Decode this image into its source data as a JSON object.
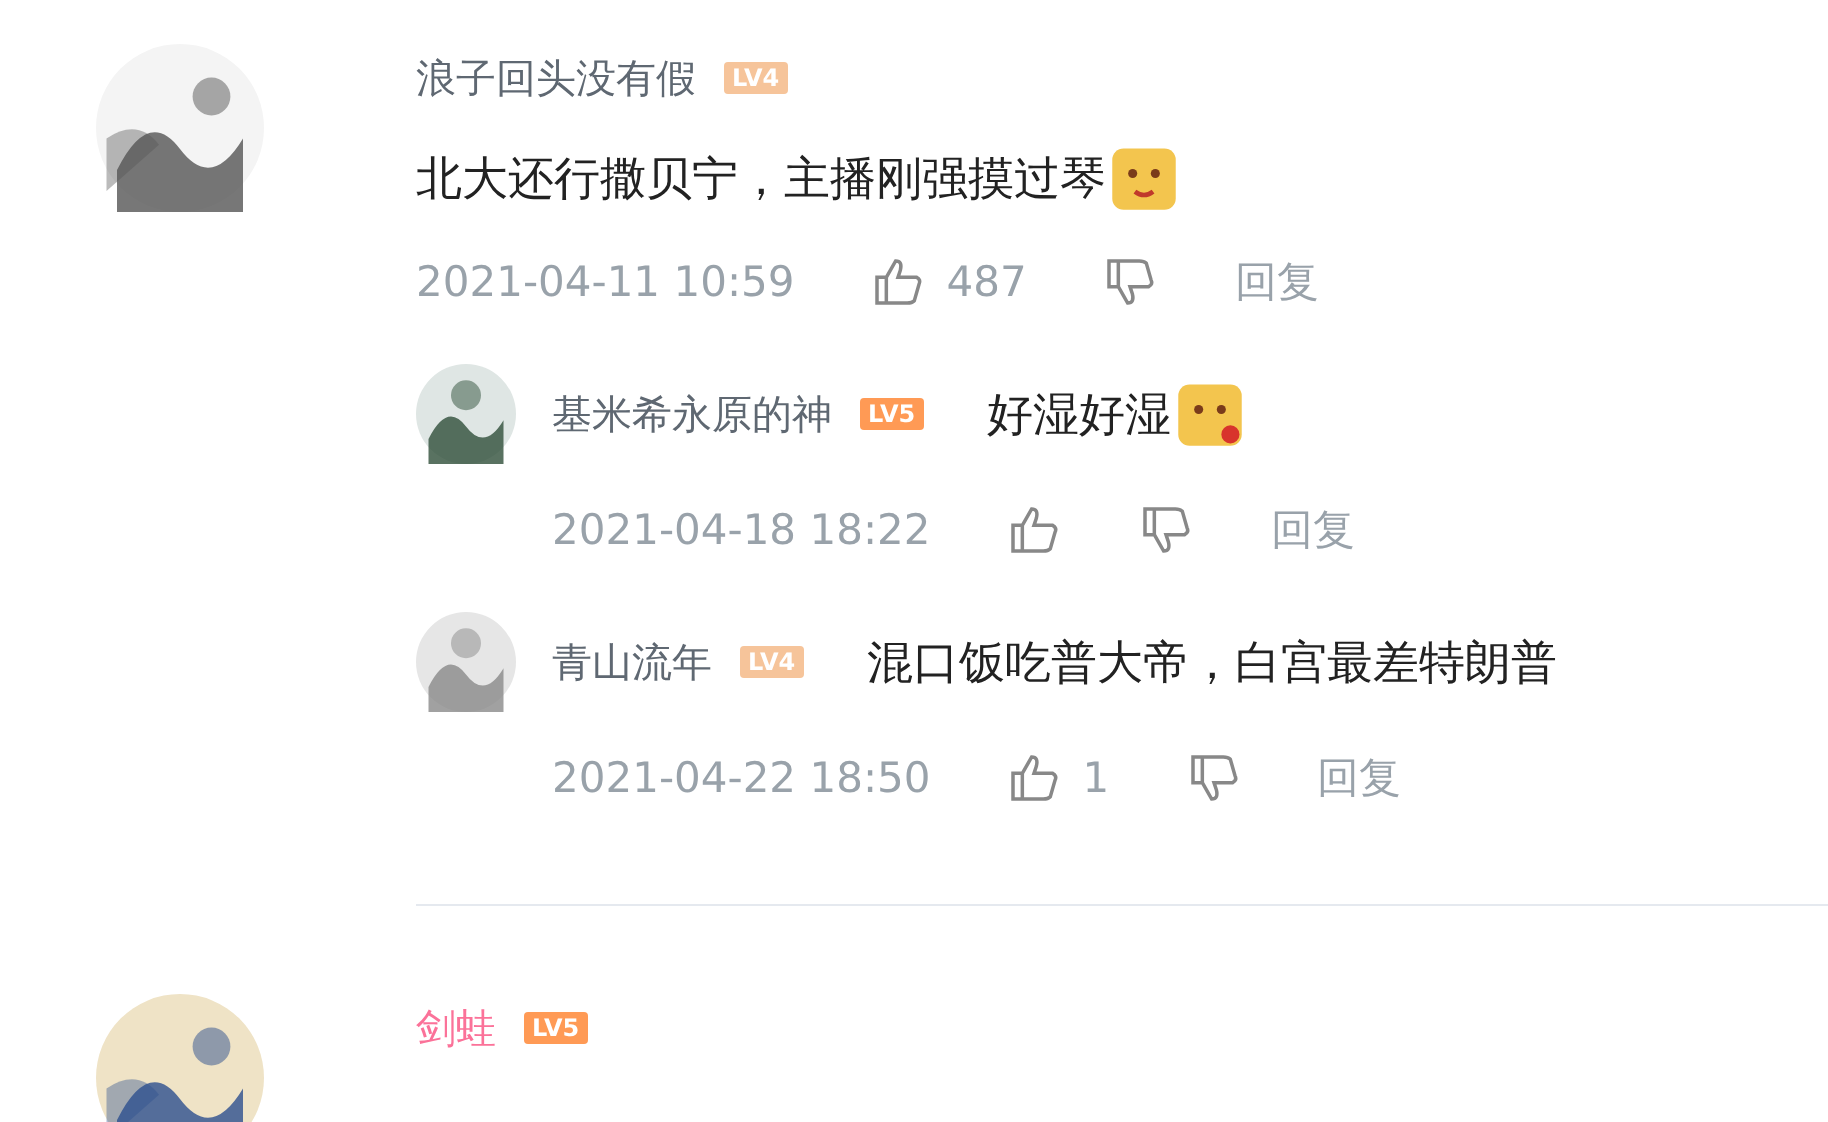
{
  "comments": [
    {
      "user": "浪子回头没有假",
      "vip": false,
      "badge": {
        "label": "LV4",
        "color": "#f6c49a"
      },
      "content": "北大还行撒贝宁，主播刚强摸过琴",
      "emoji": true,
      "time": "2021-04-11 10:59",
      "likes": "487",
      "reply_label": "回复",
      "replies": [
        {
          "user": "基米希永原的神",
          "vip": false,
          "badge": {
            "label": "LV5",
            "color": "#ff9a55"
          },
          "content": "好湿好湿",
          "emoji": true,
          "time": "2021-04-18 18:22",
          "reply_label": "回复"
        },
        {
          "user": "青山流年",
          "vip": false,
          "badge": {
            "label": "LV4",
            "color": "#f6c49a"
          },
          "content": "混口饭吃普大帝，白宫最差特朗普",
          "emoji": false,
          "time": "2021-04-22 18:50",
          "likes": "1",
          "reply_label": "回复"
        }
      ]
    },
    {
      "user": "剑蛙",
      "vip": true,
      "badge": {
        "label": "LV5",
        "color": "#ff9a55"
      }
    }
  ]
}
